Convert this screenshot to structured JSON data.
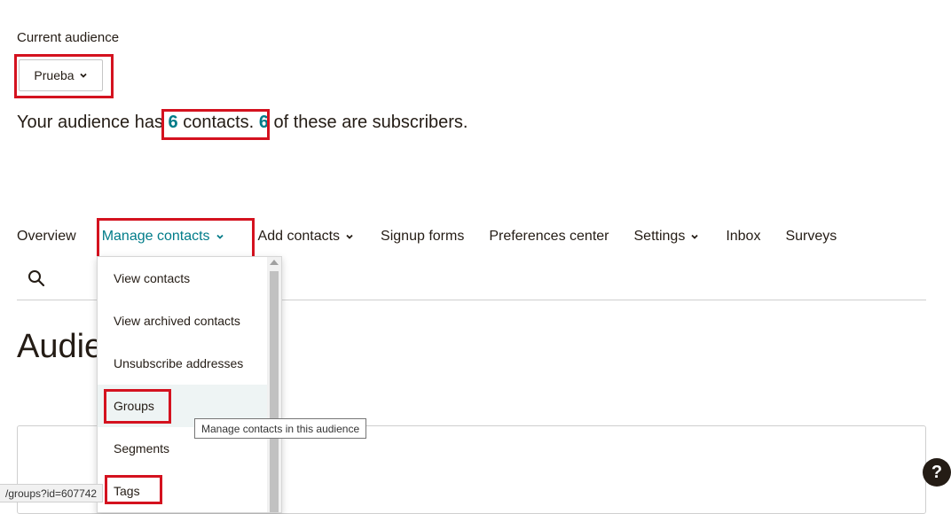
{
  "audience": {
    "label": "Current audience",
    "selected": "Prueba"
  },
  "summary": {
    "prefix": "Your audience has ",
    "contacts_count": "6",
    "contacts_text": " contacts.",
    "space": " ",
    "subscribers_count": "6",
    "subscribers_text": " of these are subscribers."
  },
  "nav": {
    "items": [
      {
        "label": "Overview",
        "has_caret": false,
        "active": false
      },
      {
        "label": "Manage contacts",
        "has_caret": true,
        "active": true
      },
      {
        "label": "Add contacts",
        "has_caret": true,
        "active": false
      },
      {
        "label": "Signup forms",
        "has_caret": false,
        "active": false
      },
      {
        "label": "Preferences center",
        "has_caret": false,
        "active": false
      },
      {
        "label": "Settings",
        "has_caret": true,
        "active": false
      },
      {
        "label": "Inbox",
        "has_caret": false,
        "active": false
      },
      {
        "label": "Surveys",
        "has_caret": false,
        "active": false
      }
    ],
    "search_icon": "search-icon"
  },
  "page": {
    "heading": "Audie"
  },
  "dropdown": {
    "items": [
      "View contacts",
      "View archived contacts",
      "Unsubscribe addresses",
      "Groups",
      "Segments",
      "Tags"
    ],
    "hovered": "Groups"
  },
  "tooltip": "Manage contacts in this audience",
  "status_url": "/groups?id=607742",
  "help_label": "?",
  "colors": {
    "accent": "#007c89",
    "text": "#241c15",
    "highlight": "#d4121f"
  }
}
